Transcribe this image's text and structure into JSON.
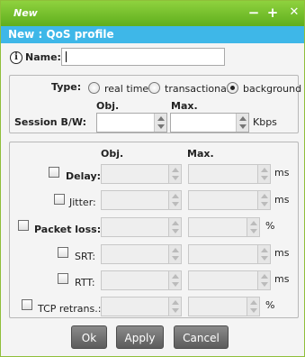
{
  "window": {
    "title": "New",
    "subtitle": "New : QoS profile"
  },
  "titlebar": {
    "minimize_glyph": "−",
    "maximize_glyph": "+",
    "close_glyph": "✕"
  },
  "name_field": {
    "label": "Name:",
    "value": "",
    "info_glyph": "i"
  },
  "type": {
    "label": "Type:",
    "options": [
      "real time",
      "transactional",
      "background"
    ],
    "selected": "background"
  },
  "session_bw": {
    "label": "Session B/W:",
    "obj_header": "Obj.",
    "max_header": "Max.",
    "unit": "Kbps",
    "obj_value": "",
    "max_value": ""
  },
  "metrics": {
    "obj_header": "Obj.",
    "max_header": "Max.",
    "rows": [
      {
        "label": "Delay:",
        "unit": "ms",
        "checked": false,
        "bold": true
      },
      {
        "label": "Jitter:",
        "unit": "ms",
        "checked": false,
        "bold": false
      },
      {
        "label": "Packet loss:",
        "unit": "%",
        "checked": false,
        "bold": true
      },
      {
        "label": "SRT:",
        "unit": "ms",
        "checked": false,
        "bold": false
      },
      {
        "label": "RTT:",
        "unit": "ms",
        "checked": false,
        "bold": false
      },
      {
        "label": "TCP retrans.:",
        "unit": "%",
        "checked": false,
        "bold": false
      }
    ]
  },
  "buttons": {
    "ok": "Ok",
    "apply": "Apply",
    "cancel": "Cancel"
  },
  "colors": {
    "titlebar": "#6fbe28",
    "subbar": "#3eb7e8",
    "button": "#6e6e6e"
  }
}
